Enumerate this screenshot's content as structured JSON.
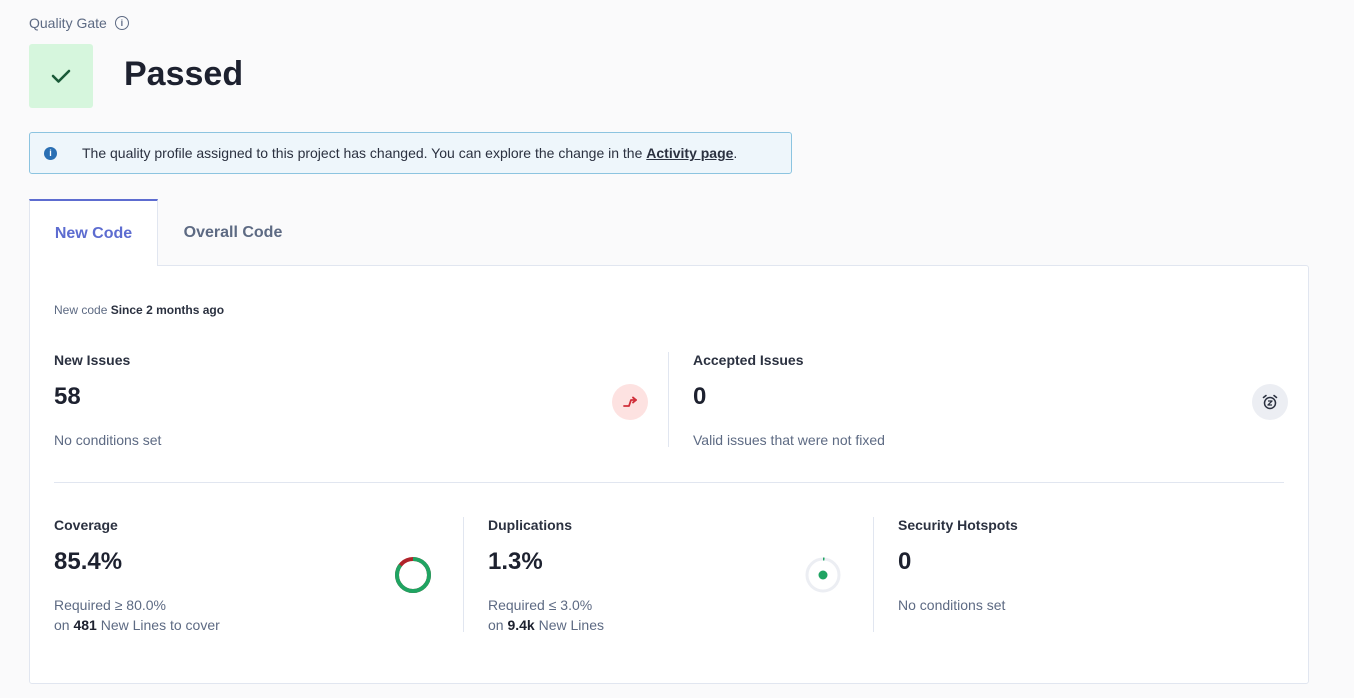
{
  "quality_gate": {
    "label": "Quality Gate",
    "status": "Passed",
    "status_color": "#d6f6dd",
    "status_icon": "check-icon"
  },
  "banner": {
    "text": "The quality profile assigned to this project has changed. You can explore the change in the ",
    "link": "Activity page",
    "suffix": "."
  },
  "tabs": [
    {
      "label": "New Code",
      "active": true
    },
    {
      "label": "Overall Code",
      "active": false
    }
  ],
  "period": {
    "prefix": "New code",
    "value": "Since 2 months ago"
  },
  "new_issues": {
    "title": "New Issues",
    "value": "58",
    "sub": "No conditions set",
    "icon": "trend-arrow-icon"
  },
  "accepted_issues": {
    "title": "Accepted Issues",
    "value": "0",
    "sub": "Valid issues that were not fixed",
    "icon": "alarm-snooze-icon"
  },
  "coverage": {
    "title": "Coverage",
    "value": "85.4%",
    "required": "Required ≥ 80.0%",
    "on_prefix": "on",
    "lines_count": "481",
    "lines_suffix": "New Lines to cover",
    "percent": 85.4
  },
  "duplications": {
    "title": "Duplications",
    "value": "1.3%",
    "required": "Required ≤ 3.0%",
    "on_prefix": "on",
    "lines_count": "9.4k",
    "lines_suffix": "New Lines",
    "percent": 1.3
  },
  "security_hotspots": {
    "title": "Security Hotspots",
    "value": "0",
    "sub": "No conditions set"
  },
  "colors": {
    "accent": "#5d6cd0",
    "pass_green": "#1fa462",
    "fail_red": "#b0232a",
    "issue_bg": "#fde2e1",
    "issue_red": "#d02f3a"
  }
}
